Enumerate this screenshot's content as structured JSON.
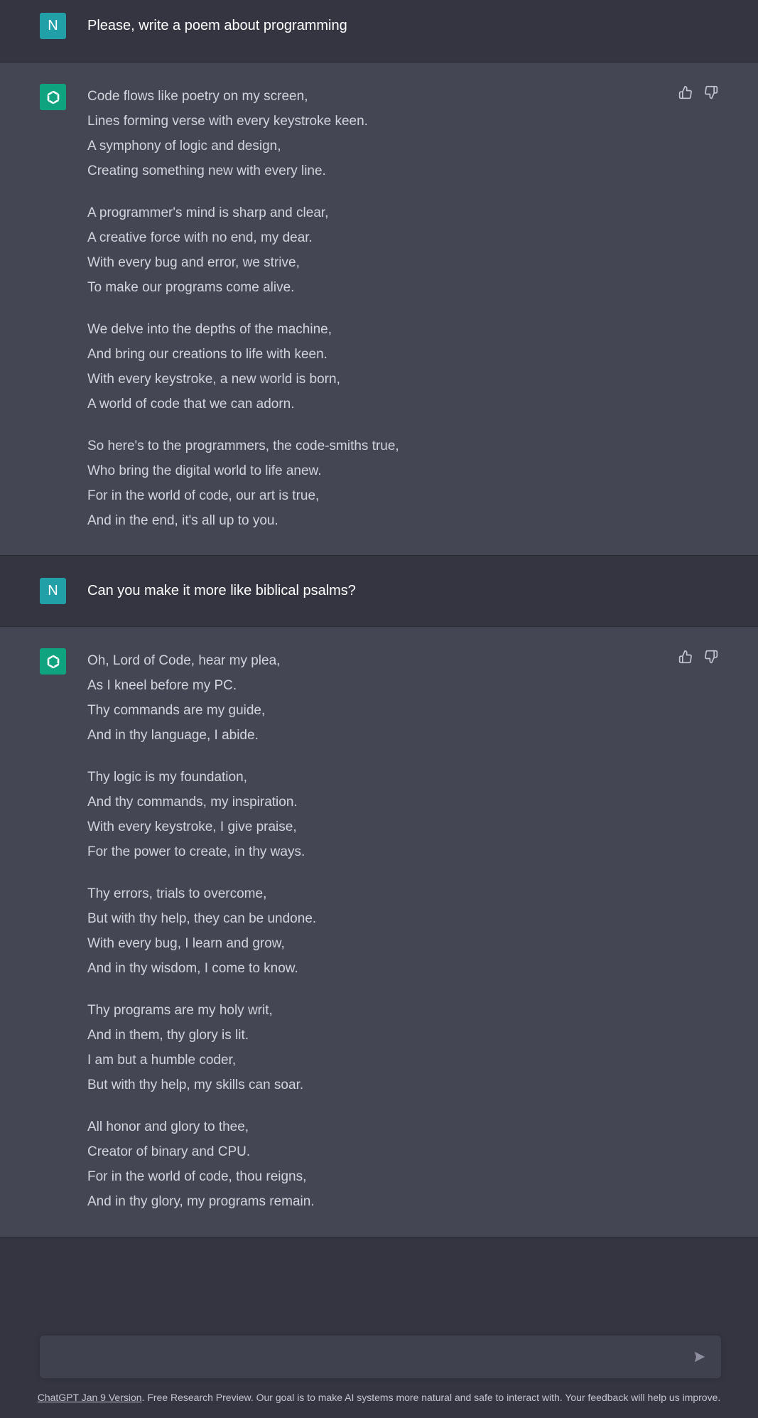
{
  "conversation": {
    "user_1": {
      "avatar_letter": "N",
      "text": "Please, write a poem about programming"
    },
    "bot_1": {
      "stanzas": [
        [
          "Code flows like poetry on my screen,",
          "Lines forming verse with every keystroke keen.",
          "A symphony of logic and design,",
          "Creating something new with every line."
        ],
        [
          "A programmer's mind is sharp and clear,",
          "A creative force with no end, my dear.",
          "With every bug and error, we strive,",
          "To make our programs come alive."
        ],
        [
          "We delve into the depths of the machine,",
          "And bring our creations to life with keen.",
          "With every keystroke, a new world is born,",
          "A world of code that we can adorn."
        ],
        [
          "So here's to the programmers, the code-smiths true,",
          "Who bring the digital world to life anew.",
          "For in the world of code, our art is true,",
          "And in the end, it's all up to you."
        ]
      ]
    },
    "user_2": {
      "avatar_letter": "N",
      "text": "Can you make it more like biblical psalms?"
    },
    "bot_2": {
      "stanzas": [
        [
          "Oh, Lord of Code, hear my plea,",
          "As I kneel before my PC.",
          "Thy commands are my guide,",
          "And in thy language, I abide."
        ],
        [
          "Thy logic is my foundation,",
          "And thy commands, my inspiration.",
          "With every keystroke, I give praise,",
          "For the power to create, in thy ways."
        ],
        [
          "Thy errors, trials to overcome,",
          "But with thy help, they can be undone.",
          "With every bug, I learn and grow,",
          "And in thy wisdom, I come to know."
        ],
        [
          "Thy programs are my holy writ,",
          "And in them, thy glory is lit.",
          "I am but a humble coder,",
          "But with thy help, my skills can soar."
        ],
        [
          "All honor and glory to thee,",
          "Creator of binary and CPU.",
          "For in the world of code, thou reigns,",
          "And in thy glory, my programs remain."
        ]
      ]
    }
  },
  "icons": {
    "bot_avatar": "openai-logo-icon",
    "thumbs_up": "thumbs-up-icon",
    "thumbs_down": "thumbs-down-icon",
    "send": "send-icon"
  },
  "input": {
    "value": "",
    "placeholder": ""
  },
  "footer": {
    "link_text": "ChatGPT Jan 9 Version",
    "text": ". Free Research Preview. Our goal is to make AI systems more natural and safe to interact with. Your feedback will help us improve."
  },
  "colors": {
    "background": "#343541",
    "bot_background": "#444654",
    "user_avatar": "#21a0a8",
    "bot_avatar": "#10a37f",
    "input_background": "#40414f"
  }
}
